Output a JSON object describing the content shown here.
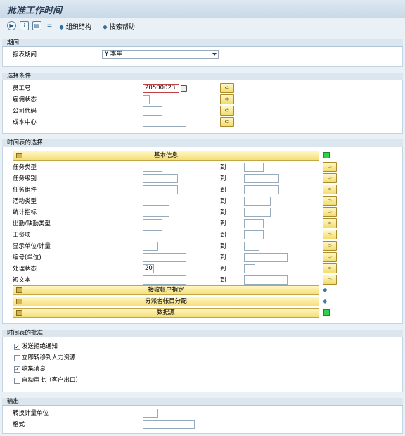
{
  "title": "批准工作时间",
  "toolbar": {
    "icons": [
      "execute-icon",
      "info-icon",
      "save-variant-icon",
      "list-icon"
    ],
    "link1": "组织结构",
    "link2": "搜索帮助"
  },
  "period": {
    "header": "期间",
    "label": "报表期间",
    "value": "Y 本年"
  },
  "selection": {
    "header": "选择条件",
    "rows": [
      {
        "label": "员工号",
        "value": "20500023"
      },
      {
        "label": "雇佣状态",
        "value": ""
      },
      {
        "label": "公司代码",
        "value": ""
      },
      {
        "label": "成本中心",
        "value": ""
      }
    ]
  },
  "timesheet": {
    "header": "时间表的选择",
    "basic_info": "基本信息",
    "to_label": "到",
    "rows": [
      {
        "label": "任务类型",
        "value": ""
      },
      {
        "label": "任务级别",
        "value": ""
      },
      {
        "label": "任务组件",
        "value": ""
      },
      {
        "label": "活动类型",
        "value": ""
      },
      {
        "label": "统计指标",
        "value": ""
      },
      {
        "label": "出勤/缺勤类型",
        "value": ""
      },
      {
        "label": "工资项",
        "value": ""
      },
      {
        "label": "显示单位/计量",
        "value": ""
      },
      {
        "label": "编号(单位)",
        "value": ""
      },
      {
        "label": "处理状态",
        "value": "20"
      },
      {
        "label": "短文本",
        "value": ""
      }
    ],
    "receiver": "接收帐户指定",
    "sender": "分派者帐目分配",
    "datasource": "数据源"
  },
  "approval": {
    "header": "时间表的批准",
    "options": [
      {
        "label": "发送拒绝通知",
        "checked": "✓"
      },
      {
        "label": "立即转移到人力资源",
        "checked": ""
      },
      {
        "label": "收集消息",
        "checked": "✓"
      },
      {
        "label": "自动审批（客户出口）",
        "checked": ""
      }
    ]
  },
  "output": {
    "header": "输出",
    "unit_label": "转换计量单位",
    "unit_value": "",
    "format_label": "格式",
    "format_value": ""
  }
}
